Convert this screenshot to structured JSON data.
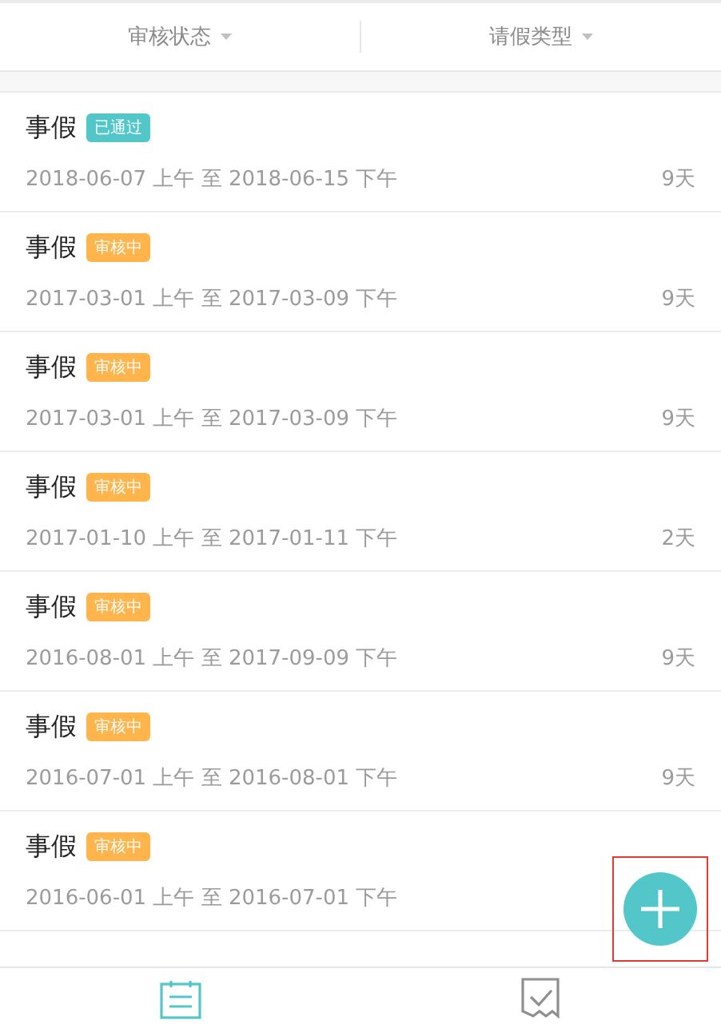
{
  "filters": [
    {
      "label": "审核状态"
    },
    {
      "label": "请假类型"
    }
  ],
  "requests": [
    {
      "type": "事假",
      "status": {
        "kind": "approved",
        "label": "已通过"
      },
      "period": "2018-06-07 上午 至 2018-06-15 下午",
      "days": "9天"
    },
    {
      "type": "事假",
      "status": {
        "kind": "pending",
        "label": "审核中"
      },
      "period": "2017-03-01 上午 至 2017-03-09 下午",
      "days": "9天"
    },
    {
      "type": "事假",
      "status": {
        "kind": "pending",
        "label": "审核中"
      },
      "period": "2017-03-01 上午 至 2017-03-09 下午",
      "days": "9天"
    },
    {
      "type": "事假",
      "status": {
        "kind": "pending",
        "label": "审核中"
      },
      "period": "2017-01-10 上午 至 2017-01-11 下午",
      "days": "2天"
    },
    {
      "type": "事假",
      "status": {
        "kind": "pending",
        "label": "审核中"
      },
      "period": "2016-08-01 上午 至 2017-09-09 下午",
      "days": "9天"
    },
    {
      "type": "事假",
      "status": {
        "kind": "pending",
        "label": "审核中"
      },
      "period": "2016-07-01 上午 至 2016-08-01 下午",
      "days": "9天"
    },
    {
      "type": "事假",
      "status": {
        "kind": "pending",
        "label": "审核中"
      },
      "period": "2016-06-01 上午 至 2016-07-01 下午"
    }
  ],
  "tab_bar": [
    {
      "kind": "calendar",
      "selected": true
    },
    {
      "kind": "approval",
      "selected": false
    }
  ]
}
